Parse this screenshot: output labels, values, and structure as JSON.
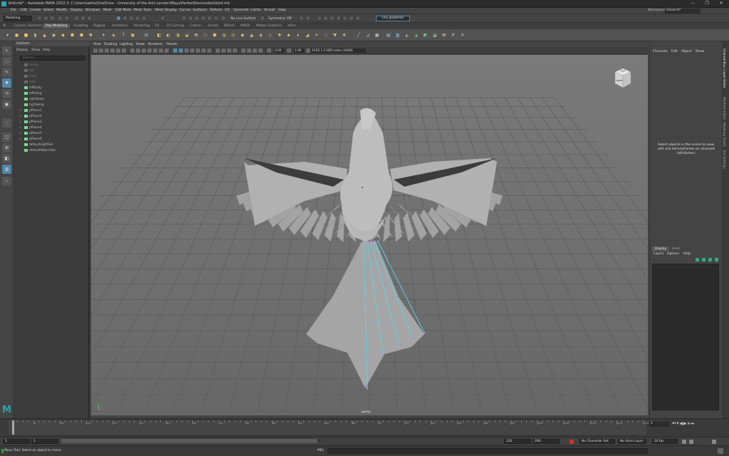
{
  "window": {
    "title": "bird.mb* - Autodesk MAYA 2022.3: C:\\Users\\adria\\OneDrive - University of the Arts London\\Maya\\PerfectDes\\models\\bird.mb",
    "minimize": "—",
    "maximize": "❐",
    "close": "✕"
  },
  "menubar": {
    "items": [
      "File",
      "Edit",
      "Create",
      "Select",
      "Modify",
      "Display",
      "Windows",
      "Mesh",
      "Edit Mesh",
      "Mesh Tools",
      "Mesh Display",
      "Curves",
      "Surfaces",
      "Deform",
      "UV",
      "Generate",
      "Cache",
      "Arnold",
      "Help"
    ],
    "workspace_label": "Workspace:",
    "workspace_value": "General*"
  },
  "statusline": {
    "mode": "Modeling",
    "live_surface": "No Live Surface",
    "symmetry": "Symmetry: Off",
    "set_name": "vira_gepbemo"
  },
  "shelf_tabs": [
    "Curves / Surfaces",
    "Poly Modeling",
    "Sculpting",
    "Rigging",
    "Animation",
    "Rendering",
    "FX",
    "FX Caching",
    "Custom",
    "Arnold",
    "Bifrost",
    "MASH",
    "Motion Graphics",
    "XGen"
  ],
  "shelf_active": "Poly Modeling",
  "outliner": {
    "title": "Outliner",
    "menu": [
      "Display",
      "Show",
      "Help"
    ],
    "search_placeholder": "Search...",
    "items": [
      {
        "label": "persp",
        "dim": true
      },
      {
        "label": "top",
        "dim": true
      },
      {
        "label": "front",
        "dim": true
      },
      {
        "label": "side",
        "dim": true
      },
      {
        "label": "leftbody",
        "dim": false
      },
      {
        "label": "leftwing",
        "dim": false
      },
      {
        "label": "rightbody",
        "dim": false
      },
      {
        "label": "rightwing",
        "dim": false
      },
      {
        "label": "pPlane1",
        "dim": false,
        "expand": true
      },
      {
        "label": "pPlane2",
        "dim": false,
        "expand": true
      },
      {
        "label": "pPlane3",
        "dim": false,
        "expand": true
      },
      {
        "label": "pPlane4",
        "dim": false,
        "expand": true
      },
      {
        "label": "pPlane5",
        "dim": false,
        "expand": true
      },
      {
        "label": "pPlane6",
        "dim": false,
        "expand": true
      },
      {
        "label": "defaultLightSet",
        "dim": false
      },
      {
        "label": "defaultObjectSet",
        "dim": false
      }
    ]
  },
  "viewport": {
    "menu": [
      "View",
      "Shading",
      "Lighting",
      "Show",
      "Renderer",
      "Panels"
    ],
    "exposure": "0.00",
    "gamma": "1.00",
    "color_space": "ACES 1.0 SDR-video (sRGB)",
    "camera_label": "persp",
    "viewcube_top": "TOP",
    "viewcube_front": "FRONT"
  },
  "channel_box": {
    "menu": [
      "Channels",
      "Edit",
      "Object",
      "Show"
    ],
    "message": "Select objects in the scene to view, edit and set keyframes on channels (attributes)."
  },
  "layer_editor": {
    "tabs": [
      "Display",
      "Anim"
    ],
    "menu": [
      "Layers",
      "Options",
      "Help"
    ]
  },
  "side_tabs": [
    "Channel Box / Layer Editor",
    "Attribute Editor",
    "Modeling Toolkit",
    "Tool Settings"
  ],
  "timeline": {
    "ticks": [
      "1",
      "5",
      "10",
      "15",
      "20",
      "25",
      "30",
      "35",
      "40",
      "45",
      "50",
      "55",
      "60",
      "65",
      "70",
      "75",
      "80",
      "85",
      "90",
      "95",
      "100",
      "105",
      "110",
      "115",
      "120"
    ],
    "current_frame": "1"
  },
  "range": {
    "start": "1",
    "inner_start": "1",
    "inner_end": "120",
    "end": "120",
    "max": "200",
    "character_set": "No Character Set",
    "anim_layer": "No Anim Layer",
    "fps": "24 fps"
  },
  "command": {
    "help": "Move Tool: Select an object to move.",
    "mel": "MEL"
  },
  "colors": {
    "accent": "#5285a6",
    "icon_orange": "#e8a04a",
    "maya_teal": "#27a7b5",
    "selection_cyan": "#4fd8f0"
  }
}
